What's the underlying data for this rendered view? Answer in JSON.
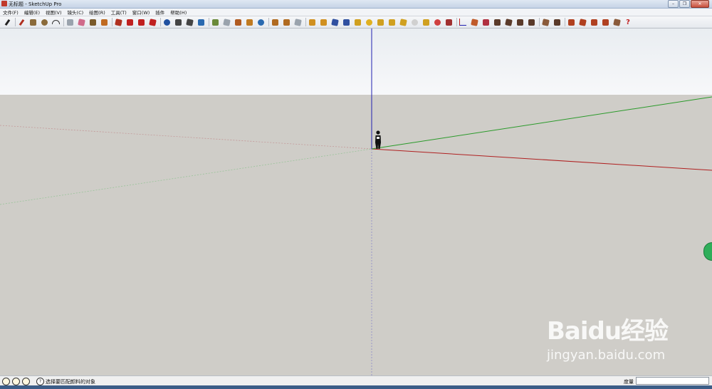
{
  "window": {
    "title": "无标题 - SketchUp Pro",
    "controls": [
      "minimize",
      "restore",
      "close"
    ]
  },
  "menubar": {
    "items": [
      {
        "label": "文件(F)"
      },
      {
        "label": "编辑(E)"
      },
      {
        "label": "视图(V)"
      },
      {
        "label": "镜头(C)"
      },
      {
        "label": "绘图(R)"
      },
      {
        "label": "工具(T)"
      },
      {
        "label": "窗口(W)"
      },
      {
        "label": "插件"
      },
      {
        "label": "帮助(H)"
      }
    ]
  },
  "toolbar": {
    "tools": [
      {
        "name": "select-tool",
        "icon": "select-icon",
        "color": "#222222"
      },
      {
        "name": "line-tool",
        "icon": "pencil-icon",
        "color": "#b03020"
      },
      {
        "name": "rectangle-tool",
        "icon": "rectangle-icon",
        "color": "#8a6a3a"
      },
      {
        "name": "circle-tool",
        "icon": "circle-icon",
        "color": "#8a6a3a"
      },
      {
        "name": "arc-tool",
        "icon": "arc-icon",
        "color": "#333333"
      },
      {
        "name": "make-component-tool",
        "icon": "component-icon",
        "color": "#9aa3ad"
      },
      {
        "name": "eraser-tool",
        "icon": "eraser-icon",
        "color": "#d06a8a"
      },
      {
        "name": "tape-measure-tool",
        "icon": "tape-icon",
        "color": "#7a5a2a"
      },
      {
        "name": "paint-bucket-tool",
        "icon": "bucket-icon",
        "color": "#c06a20"
      },
      {
        "name": "push-pull-tool",
        "icon": "push-pull-icon",
        "color": "#b03020"
      },
      {
        "name": "move-tool",
        "icon": "move-icon",
        "color": "#c02020"
      },
      {
        "name": "rotate-tool",
        "icon": "rotate-icon",
        "color": "#c02020"
      },
      {
        "name": "offset-tool",
        "icon": "offset-icon",
        "color": "#c02020"
      },
      {
        "name": "orbit-tool",
        "icon": "orbit-icon",
        "color": "#2050a0"
      },
      {
        "name": "pan-tool",
        "icon": "hand-icon",
        "color": "#444444"
      },
      {
        "name": "zoom-tool",
        "icon": "magnifier-icon",
        "color": "#444444"
      },
      {
        "name": "zoom-extents-tool",
        "icon": "zoom-extents-icon",
        "color": "#2a6ab0"
      },
      {
        "name": "add-location-tool",
        "icon": "location-icon",
        "color": "#6a8a3a"
      },
      {
        "name": "toggle-terrain-tool",
        "icon": "terrain-icon",
        "color": "#9aa3ad"
      },
      {
        "name": "add-building-tool",
        "icon": "building-icon",
        "color": "#b05a20"
      },
      {
        "name": "photo-texture-tool",
        "icon": "photo-icon",
        "color": "#c07a20"
      },
      {
        "name": "google-earth-tool",
        "icon": "globe-icon",
        "color": "#2a6ab0"
      },
      {
        "name": "get-models-tool",
        "icon": "models-icon",
        "color": "#b06a20"
      },
      {
        "name": "share-model-tool",
        "icon": "share-icon",
        "color": "#b06a20"
      },
      {
        "name": "extension-warehouse-tool",
        "icon": "warehouse-icon",
        "color": "#9aa3ad"
      },
      {
        "name": "plugin-tool-1",
        "icon": "plugin-icon",
        "color": "#d09020"
      },
      {
        "name": "plugin-tool-2",
        "icon": "plugin-icon",
        "color": "#d09020"
      },
      {
        "name": "plugin-tool-3",
        "icon": "plugin-icon",
        "color": "#3050a0"
      },
      {
        "name": "plugin-tool-4",
        "icon": "plugin-icon",
        "color": "#3050a0"
      },
      {
        "name": "plugin-tool-5",
        "icon": "plugin-icon",
        "color": "#d0a020"
      },
      {
        "name": "sun-tool",
        "icon": "sun-icon",
        "color": "#e0b020"
      },
      {
        "name": "plugin-tool-6",
        "icon": "plugin-icon",
        "color": "#d0a020"
      },
      {
        "name": "flag-tool",
        "icon": "flag-icon",
        "color": "#d0a020"
      },
      {
        "name": "plugin-tool-7",
        "icon": "plugin-icon",
        "color": "#d0a020"
      },
      {
        "name": "sphere-tool",
        "icon": "sphere-icon",
        "color": "#d0d0d0"
      },
      {
        "name": "plugin-tool-8",
        "icon": "plugin-icon",
        "color": "#d0a020"
      },
      {
        "name": "color-wheel-tool",
        "icon": "color-wheel-icon",
        "color": "#d04040"
      },
      {
        "name": "plugin-tool-9",
        "icon": "plugin-icon",
        "color": "#a03030"
      },
      {
        "name": "axes-tool",
        "icon": "axes-icon",
        "color": "#c02020"
      },
      {
        "name": "plugin-tool-10",
        "icon": "plugin-icon",
        "color": "#c05a2a"
      },
      {
        "name": "plugin-tool-11",
        "icon": "plugin-icon",
        "color": "#b03040"
      },
      {
        "name": "plugin-tool-12",
        "icon": "plugin-icon",
        "color": "#5a3a2a"
      },
      {
        "name": "plugin-tool-13",
        "icon": "plugin-icon",
        "color": "#5a3a2a"
      },
      {
        "name": "plugin-tool-14",
        "icon": "plugin-icon",
        "color": "#5a3a2a"
      },
      {
        "name": "plugin-tool-15",
        "icon": "plugin-icon",
        "color": "#5a3a2a"
      },
      {
        "name": "plugin-tool-16",
        "icon": "plugin-icon",
        "color": "#8a5a3a"
      },
      {
        "name": "plugin-tool-17",
        "icon": "plugin-icon",
        "color": "#5a3a2a"
      },
      {
        "name": "plugin-tool-18",
        "icon": "plugin-icon",
        "color": "#b04020"
      },
      {
        "name": "plugin-tool-19",
        "icon": "plugin-icon",
        "color": "#b04020"
      },
      {
        "name": "plugin-tool-20",
        "icon": "plugin-icon",
        "color": "#b04020"
      },
      {
        "name": "plugin-tool-21",
        "icon": "plugin-icon",
        "color": "#b04020"
      },
      {
        "name": "plugin-tool-22",
        "icon": "plugin-icon",
        "color": "#8a5a3a"
      },
      {
        "name": "help-tool",
        "icon": "help-icon",
        "color": "#c02020"
      }
    ]
  },
  "scene": {
    "sky_color": "#eef1f4",
    "ground_color": "#cfcdc8",
    "axis_colors": {
      "red": "#b02020",
      "green": "#2a9a2a",
      "blue": "#2020b0"
    },
    "figure_icon": "person-icon"
  },
  "watermark": {
    "logo": "Baidu经验",
    "subtitle": "jingyan.baidu.com"
  },
  "statusbar": {
    "icons": [
      "geo-location-icon",
      "credits-icon",
      "user-icon"
    ],
    "help_icon": "help-icon",
    "message": "选择要匹配颜料的对象",
    "measure_label": "度量",
    "measure_value": ""
  }
}
